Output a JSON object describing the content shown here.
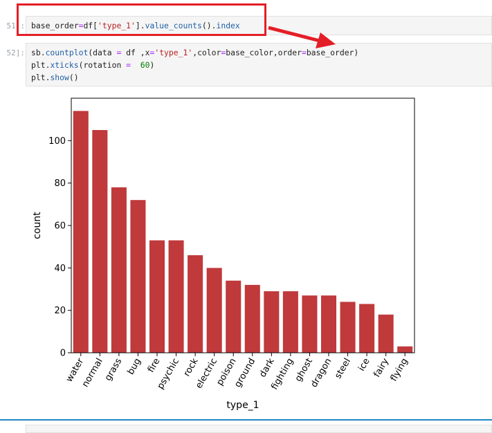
{
  "cells": [
    {
      "prompt": "51]:",
      "tokens": [
        {
          "t": "base_order",
          "c": ""
        },
        {
          "t": "=",
          "c": "op"
        },
        {
          "t": "df[",
          "c": ""
        },
        {
          "t": "'type_1'",
          "c": "str"
        },
        {
          "t": "].",
          "c": ""
        },
        {
          "t": "value_counts",
          "c": "fn"
        },
        {
          "t": "().",
          "c": ""
        },
        {
          "t": "index",
          "c": "fn"
        }
      ]
    },
    {
      "prompt": "52]:",
      "lines": [
        [
          {
            "t": "sb.",
            "c": ""
          },
          {
            "t": "countplot",
            "c": "fn"
          },
          {
            "t": "(data ",
            "c": ""
          },
          {
            "t": "=",
            "c": "op"
          },
          {
            "t": " df ,x",
            "c": ""
          },
          {
            "t": "=",
            "c": "op"
          },
          {
            "t": "'type_1'",
            "c": "str"
          },
          {
            "t": ",color",
            "c": ""
          },
          {
            "t": "=",
            "c": "op"
          },
          {
            "t": "base_color,order",
            "c": ""
          },
          {
            "t": "=",
            "c": "op"
          },
          {
            "t": "base_order)",
            "c": ""
          }
        ],
        [
          {
            "t": "plt.",
            "c": ""
          },
          {
            "t": "xticks",
            "c": "fn"
          },
          {
            "t": "(rotation ",
            "c": ""
          },
          {
            "t": "=",
            "c": "op"
          },
          {
            "t": "  ",
            "c": ""
          },
          {
            "t": "60",
            "c": "num"
          },
          {
            "t": ")",
            "c": ""
          }
        ],
        [
          {
            "t": "plt.",
            "c": ""
          },
          {
            "t": "show",
            "c": "fn"
          },
          {
            "t": "()",
            "c": ""
          }
        ]
      ]
    }
  ],
  "annotation_color": "#e41e26",
  "bar_color": "#c0393b",
  "chart_data": {
    "type": "bar",
    "categories": [
      "water",
      "normal",
      "grass",
      "bug",
      "fire",
      "psychic",
      "rock",
      "electric",
      "poison",
      "ground",
      "dark",
      "fighting",
      "ghost",
      "dragon",
      "steel",
      "ice",
      "fairy",
      "flying"
    ],
    "values": [
      114,
      105,
      78,
      72,
      53,
      53,
      46,
      40,
      34,
      32,
      29,
      29,
      27,
      27,
      24,
      23,
      18,
      3
    ],
    "xlabel": "type_1",
    "ylabel": "count",
    "ylim": [
      0,
      120
    ],
    "yticks": [
      0,
      20,
      40,
      60,
      80,
      100
    ],
    "tick_rotation": 60,
    "grid": false
  }
}
